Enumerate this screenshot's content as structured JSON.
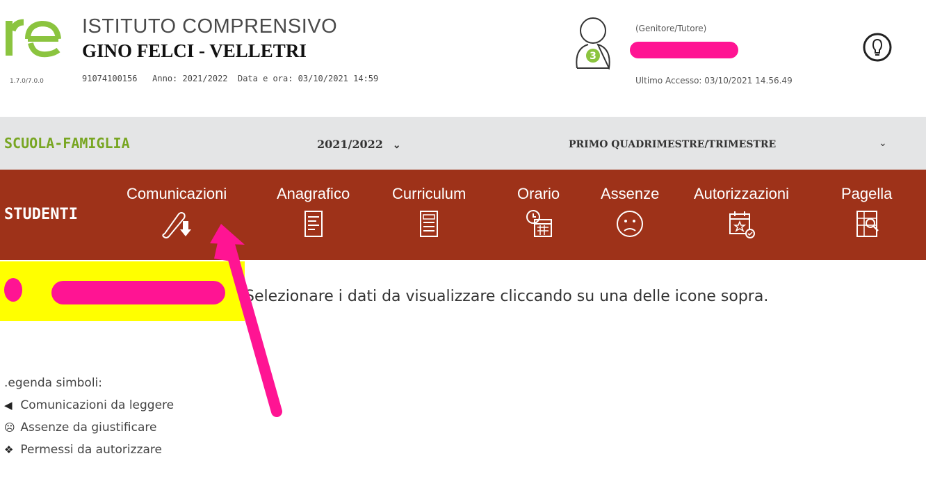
{
  "header": {
    "version": "1.7.0/7.0.0",
    "school_line1": "ISTITUTO COMPRENSIVO",
    "school_line2": "GINO FELCI - VELLETRI",
    "meta": "91074100156   Anno: 2021/2022  Data e ora: 03/10/2021 14:59",
    "avatar_count": "3",
    "role": "(Genitore/Tutore)",
    "last_access": "Ultimo Accesso: 03/10/2021 14.56.49"
  },
  "subbar": {
    "section_title": "SCUOLA-FAMIGLIA",
    "year": "2021/2022",
    "period": "PRIMO QUADRIMESTRE/TRIMESTRE",
    "chevron": "⌄"
  },
  "navbar": {
    "students_label": "STUDENTI",
    "items": [
      {
        "label": "Comunicazioni",
        "icon": "scroll-download-icon"
      },
      {
        "label": "Anagrafico",
        "icon": "document-icon"
      },
      {
        "label": "Curriculum",
        "icon": "list-document-icon"
      },
      {
        "label": "Orario",
        "icon": "calendar-clock-icon"
      },
      {
        "label": "Assenze",
        "icon": "sad-face-icon"
      },
      {
        "label": "Autorizzazioni",
        "icon": "calendar-star-icon"
      },
      {
        "label": "Pagella",
        "icon": "report-card-icon"
      }
    ]
  },
  "content": {
    "instruction": "Selezionare i dati da visualizzare cliccando su una delle icone sopra.",
    "legend_title": ".egenda simboli:",
    "legend": [
      {
        "icon": "megaphone-icon",
        "label": "Comunicazioni da leggere"
      },
      {
        "icon": "sad-face-icon",
        "label": "Assenze da giustificare"
      },
      {
        "icon": "paw-icon",
        "label": "Permessi da autorizzare"
      }
    ]
  },
  "colors": {
    "brand_green": "#78a622",
    "nav_brown": "#9e3219",
    "grey_bar": "#e4e5e6",
    "highlight_yellow": "#ffff00",
    "annotation_pink": "#ff1493"
  }
}
